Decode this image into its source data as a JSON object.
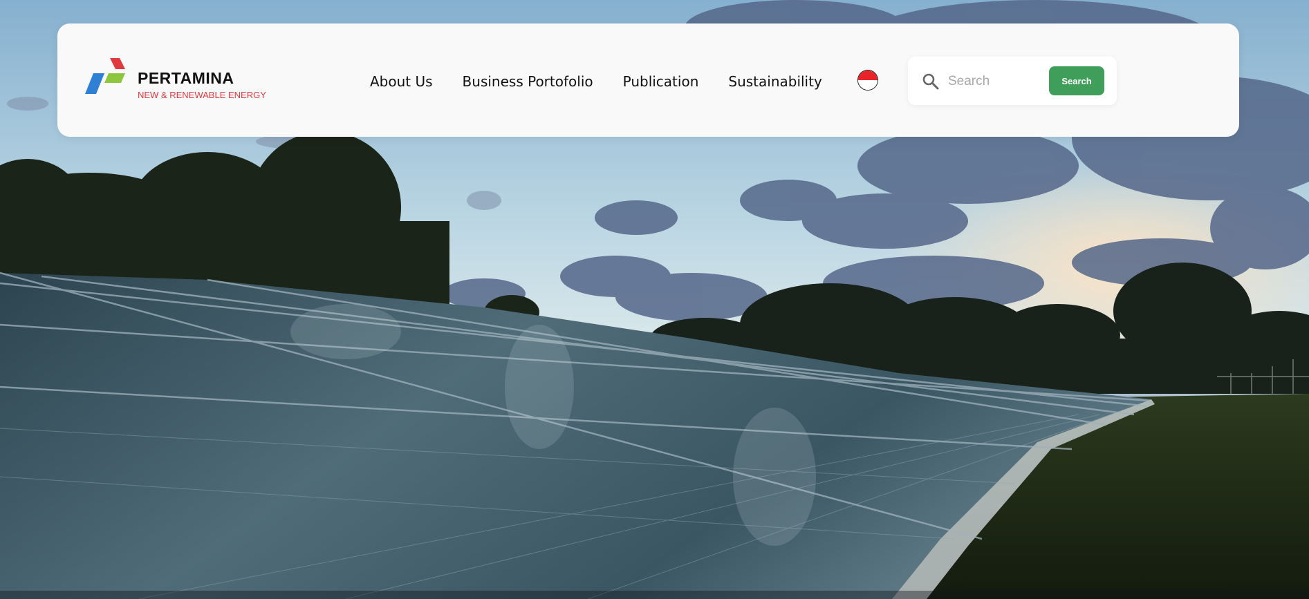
{
  "hero": {
    "image": "solar-panel-field-at-dusk",
    "colors": {
      "sky_top": "#8fb7d2",
      "sky_mid": "#c5dde6",
      "sunset_glow": "#f3c9a8",
      "cloud": "#5d6f8d",
      "trees": "#1a2219",
      "grass": "#1f2a17",
      "panel": "#3c5662"
    }
  },
  "logo": {
    "name": "PERTAMINA",
    "tagline": "NEW & RENEWABLE ENERGY",
    "colors": {
      "red": "#e03a3e",
      "blue": "#2f7fd4",
      "green": "#8dc63f"
    }
  },
  "nav": {
    "items": [
      {
        "label": "About Us"
      },
      {
        "label": "Business Portofolio"
      },
      {
        "label": "Publication"
      },
      {
        "label": "Sustainability"
      }
    ],
    "language_flag": "indonesia-flag"
  },
  "search": {
    "placeholder": "Search",
    "value": "",
    "button_label": "Search",
    "button_color": "#3e9e5a"
  }
}
